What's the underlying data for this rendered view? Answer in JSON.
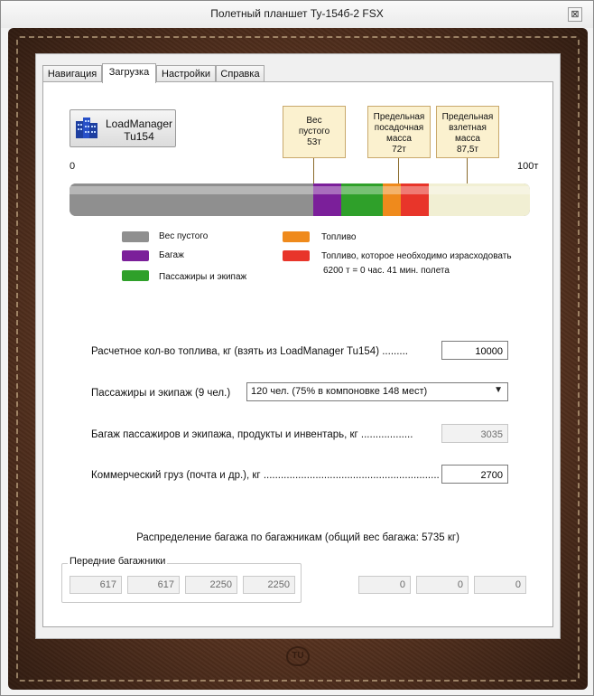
{
  "window": {
    "title": "Полетный планшет Ту-154б-2 FSX",
    "close_label": "⊠"
  },
  "tabs": [
    {
      "label": "Навигация",
      "active": false
    },
    {
      "label": "Загрузка",
      "active": true
    },
    {
      "label": "Настройки",
      "active": false
    },
    {
      "label": "Справка",
      "active": false
    }
  ],
  "load_manager": {
    "label_line1": "LoadManager",
    "label_line2": "Tu154"
  },
  "callouts": [
    {
      "line1": "Вес",
      "line2": "пустого",
      "line3": "53т"
    },
    {
      "line1": "Предельная",
      "line2": "посадочная",
      "line3": "масса",
      "line4": "72т"
    },
    {
      "line1": "Предельная",
      "line2": "взлетная",
      "line3": "масса",
      "line4": "87,5т"
    }
  ],
  "scale": {
    "min_label": "0",
    "max_label": "100т"
  },
  "load_bar": {
    "segments": [
      {
        "name": "empty-weight",
        "color": "#8f8f8f",
        "from_t": 0,
        "to_t": 53
      },
      {
        "name": "baggage",
        "color": "#7b1f9a",
        "from_t": 53,
        "to_t": 59
      },
      {
        "name": "passengers",
        "color": "#2fa02a",
        "from_t": 59,
        "to_t": 68
      },
      {
        "name": "fuel",
        "color": "#ef8a1c",
        "from_t": 68,
        "to_t": 72
      },
      {
        "name": "fuel-burned",
        "color": "#e8352a",
        "from_t": 72,
        "to_t": 78
      },
      {
        "name": "free",
        "color": "#f1efd3",
        "from_t": 78,
        "to_t": 100
      }
    ]
  },
  "legend": {
    "empty": "Вес пустого",
    "baggage": "Багаж",
    "passengers": "Пассажиры и экипаж",
    "fuel": "Топливо",
    "fuel_burn": "Топливо, которое необходимо израсходовать",
    "fuel_burn_note": "6200 т = 0 час. 41 мин. полета",
    "colors": {
      "empty": "#8f8f8f",
      "baggage": "#7b1f9a",
      "passengers": "#2fa02a",
      "fuel": "#ef8a1c",
      "fuel_burn": "#e8352a"
    }
  },
  "form": {
    "fuel_label": "Расчетное кол-во топлива, кг (взять из LoadManager Tu154) .........",
    "fuel_value": "10000",
    "pax_label": "Пассажиры и экипаж (9 чел.)",
    "pax_selected": "120 чел. (75% в компоновке 148 мест)",
    "baggage_label": "Багаж пассажиров и экипажа, продукты и инвентарь, кг ..................",
    "baggage_value": "3035",
    "cargo_label": "Коммерческий груз (почта и др.), кг ..................................................................",
    "cargo_value": "2700"
  },
  "distribution": {
    "title": "Распределение багажа по багажникам (общий вес багажа: 5735 кг)",
    "front_group_label": "Передние багажники",
    "front": [
      "617",
      "617",
      "2250",
      "2250"
    ],
    "rear": [
      "0",
      "0",
      "0"
    ]
  }
}
